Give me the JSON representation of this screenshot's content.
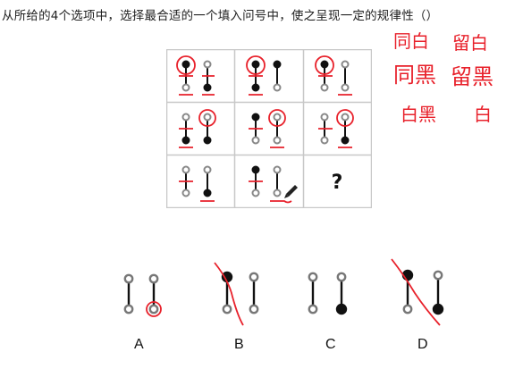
{
  "question": {
    "text": "从所给的4个选项中，选择最合适的一个填入问号中，使之呈现一定的规律性（）"
  },
  "grid": {
    "unknown_cell": "?"
  },
  "handwritten_notes": {
    "note_1": "同白",
    "note_2": "留白",
    "note_3": "同黑",
    "note_4": "留黑",
    "note_5": "白黑",
    "note_6": "白"
  },
  "options": {
    "labels": [
      "A",
      "B",
      "C",
      "D"
    ]
  },
  "colors": {
    "annotation": "#e8212b",
    "grid_border": "#c8c8c8",
    "stroke": "#111111"
  }
}
